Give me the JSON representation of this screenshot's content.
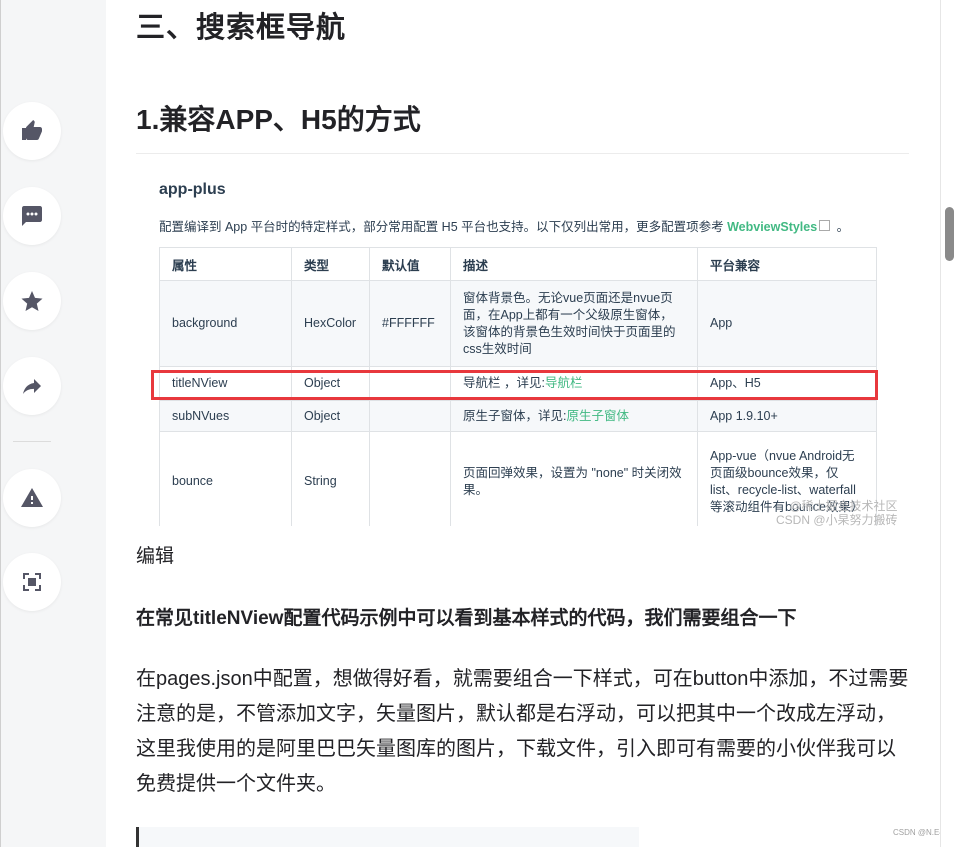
{
  "article": {
    "h2": "三、搜索框导航",
    "h3": "1.兼容APP、H5的方式",
    "caption": "编辑",
    "bold_line": "在常见titleNView配置代码示例中可以看到基本样式的代码，我们需要组合一下",
    "paragraph": "在pages.json中配置，想做得好看，就需要组合一下样式，可在button中添加，不过需要注意的是，不管添加文字，矢量图片，默认都是右浮动，可以把其中一个改成左浮动，这里我使用的是阿里巴巴矢量图库的图片，下载文件，引入即可有需要的小伙伴我可以免费提供一个文件夹。"
  },
  "toolbar": {
    "icons": [
      "thumbs-up-icon",
      "comment-icon",
      "star-icon",
      "share-icon",
      "warning-icon",
      "fullscreen-icon"
    ]
  },
  "screenshot": {
    "title": "app-plus",
    "desc_prefix": "配置编译到 App 平台时的特定样式，部分常用配置 H5 平台也支持。以下仅列出常用，更多配置项参考 ",
    "desc_link": "WebviewStyles",
    "desc_suffix": " 。",
    "headers": [
      "属性",
      "类型",
      "默认值",
      "描述",
      "平台兼容"
    ],
    "rows": [
      {
        "prop": "background",
        "type": "HexColor",
        "default": "#FFFFFF",
        "desc": "窗体背景色。无论vue页面还是nvue页面，在App上都有一个父级原生窗体，该窗体的背景色生效时间快于页面里的css生效时间",
        "platform": "App"
      },
      {
        "prop": "titleNView",
        "type": "Object",
        "default": "",
        "desc_prefix": "导航栏 ，详见:",
        "desc_link": "导航栏",
        "platform": "App、H5"
      },
      {
        "prop": "subNVues",
        "type": "Object",
        "default": "",
        "desc_prefix": "原生子窗体，详见:",
        "desc_link": "原生子窗体",
        "platform": "App 1.9.10+"
      },
      {
        "prop": "bounce",
        "type": "String",
        "default": "",
        "desc": "页面回弹效果，设置为 \"none\" 时关闭效果。",
        "platform": "App-vue（nvue Android无页面级bounce效果，仅list、recycle-list、waterfall等滚动组件有bounce效果）"
      }
    ],
    "watermark_1": "@稀土掘金技术社区",
    "watermark_2": "CSDN @小杲努力搬砖"
  },
  "footer": {
    "corner_mark": "CSDN @N.E4"
  },
  "colors": {
    "highlight": "#e8383d",
    "link_green": "#42b983"
  }
}
